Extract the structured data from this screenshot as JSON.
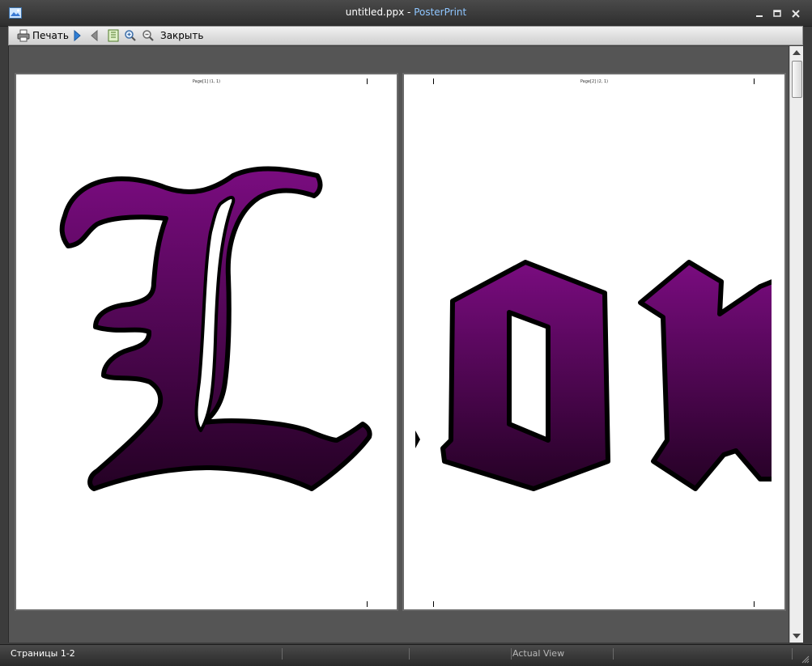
{
  "window": {
    "title_file": "untitled.ppx",
    "title_sep": " - ",
    "title_app": "PosterPrint"
  },
  "toolbar": {
    "print_label": "Печать",
    "close_label": "Закрыть"
  },
  "pages": [
    {
      "header": "Page[1] (1, 1)",
      "letters": "L"
    },
    {
      "header": "Page[2] (2, 1)",
      "letters": "on"
    }
  ],
  "colors": {
    "glyph_top": "#7a0c80",
    "glyph_bottom": "#240124",
    "glyph_outline": "#000000",
    "title_app": "#8fc6ff"
  },
  "statusbar": {
    "pages_label": "Страницы 1-2",
    "view_label": "Actual View"
  }
}
